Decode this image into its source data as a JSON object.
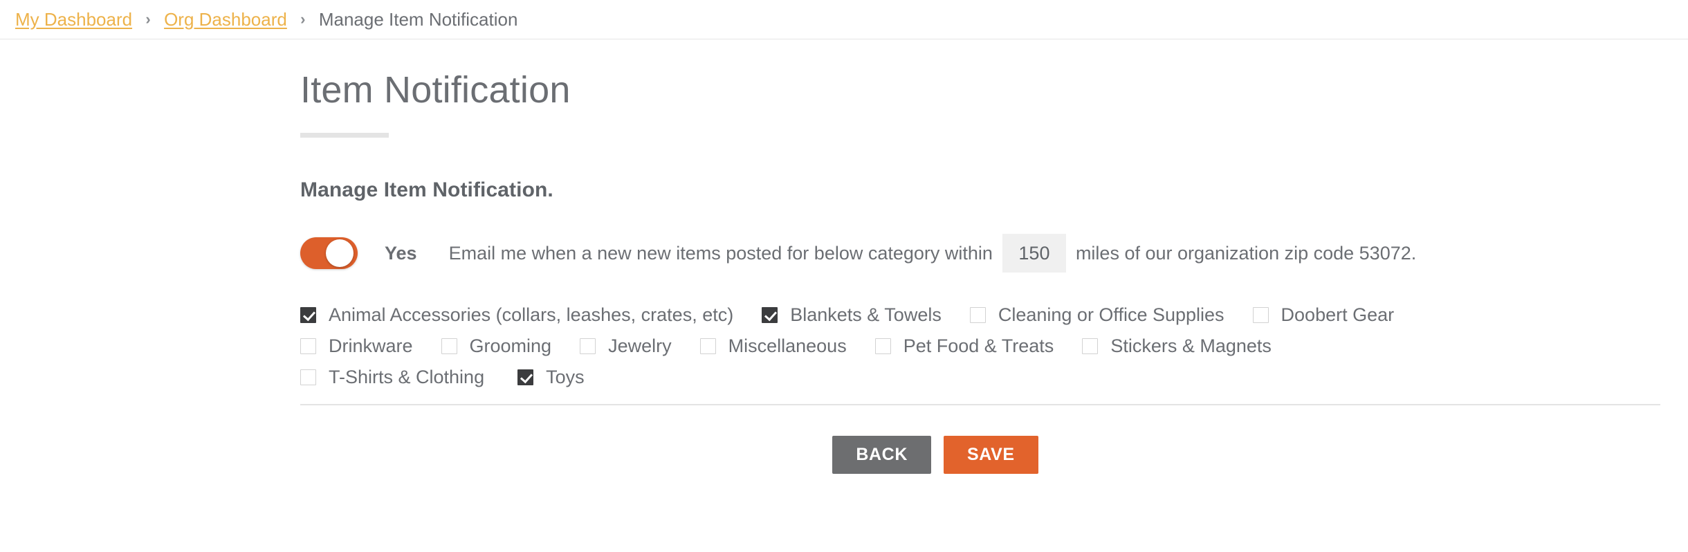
{
  "breadcrumb": {
    "items": [
      {
        "label": "My Dashboard",
        "type": "link"
      },
      {
        "label": "Org Dashboard",
        "type": "link"
      },
      {
        "label": "Manage Item Notification",
        "type": "current"
      }
    ],
    "separator": "›"
  },
  "page": {
    "title": "Item Notification",
    "section_heading": "Manage Item Notification."
  },
  "notification": {
    "toggle_state_label": "Yes",
    "toggle_on": true,
    "text_before_input": "Email me when a new new items posted for below category within",
    "miles_value": "150",
    "miles_placeholder": "150",
    "text_after_input": "miles of our organization zip code 53072."
  },
  "categories": {
    "rows": [
      [
        {
          "label": "Animal Accessories (collars, leashes, crates, etc)",
          "checked": true
        },
        {
          "label": "Blankets & Towels",
          "checked": true
        },
        {
          "label": "Cleaning or Office Supplies",
          "checked": false
        },
        {
          "label": "Doobert Gear",
          "checked": false
        }
      ],
      [
        {
          "label": "Drinkware",
          "checked": false
        },
        {
          "label": "Grooming",
          "checked": false
        },
        {
          "label": "Jewelry",
          "checked": false
        },
        {
          "label": "Miscellaneous",
          "checked": false
        },
        {
          "label": "Pet Food & Treats",
          "checked": false
        },
        {
          "label": "Stickers & Magnets",
          "checked": false
        }
      ],
      [
        {
          "label": "T-Shirts & Clothing",
          "checked": false
        },
        {
          "label": "Toys",
          "checked": true
        }
      ]
    ]
  },
  "actions": {
    "back_label": "BACK",
    "save_label": "SAVE"
  },
  "colors": {
    "accent_orange": "#e2632c",
    "toggle_orange": "#dd5f2b",
    "link_amber": "#edb24a",
    "text_gray": "#6b6e73",
    "button_gray": "#6d6e70",
    "checkbox_dark": "#3b3c3e"
  }
}
